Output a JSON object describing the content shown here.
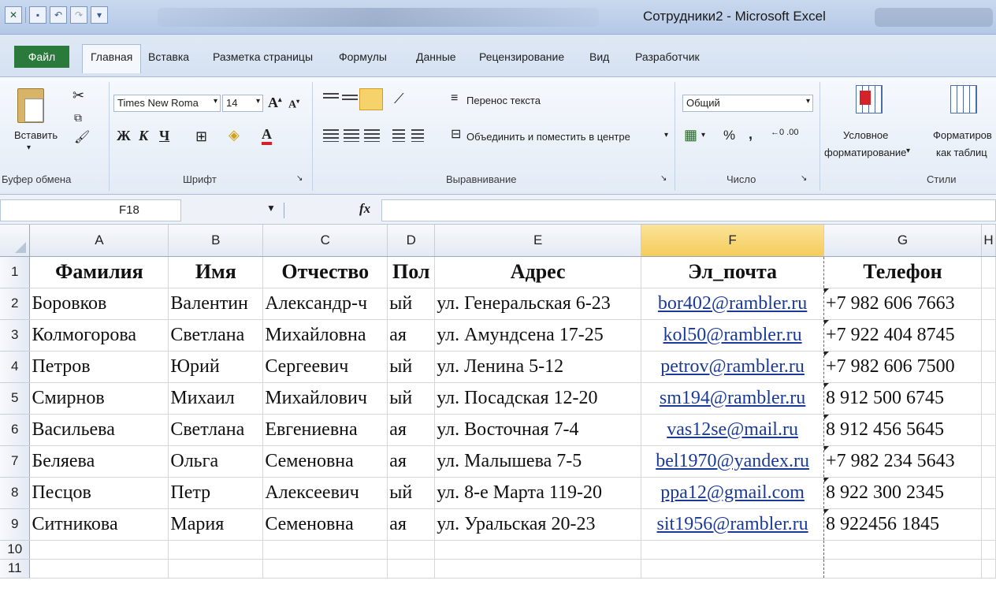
{
  "window": {
    "title": "Сотрудники2 - Microsoft Excel"
  },
  "tabs": {
    "file": "Файл",
    "items": [
      "Главная",
      "Вставка",
      "Разметка страницы",
      "Формулы",
      "Данные",
      "Рецензирование",
      "Вид",
      "Разработчик"
    ]
  },
  "ribbon": {
    "clipboard": {
      "paste_label": "Вставить",
      "group_label": "Буфер обмена"
    },
    "font": {
      "name": "Times New Roma",
      "size": "14",
      "bold": "Ж",
      "italic": "К",
      "underline": "Ч",
      "group_label": "Шрифт"
    },
    "alignment": {
      "wrap_text": "Перенос текста",
      "merge_center": "Объединить и поместить в центре",
      "group_label": "Выравнивание"
    },
    "number": {
      "format": "Общий",
      "percent": "%",
      "comma": ",",
      "group_label": "Число"
    },
    "styles": {
      "conditional_line1": "Условное",
      "conditional_line2": "форматирование",
      "format_table_line1": "Форматиров",
      "format_table_line2": "как таблиц",
      "group_label": "Стили"
    }
  },
  "formula_bar": {
    "name_box": "F18",
    "fx": "fx",
    "value": ""
  },
  "grid": {
    "columns": [
      "A",
      "B",
      "C",
      "D",
      "E",
      "F",
      "G",
      "H"
    ],
    "selected_column": "F",
    "rows": [
      {
        "n": "1",
        "cells": [
          "Фамилия",
          "Имя",
          "Отчество",
          "Пол",
          "Адрес",
          "Эл_почта",
          "Телефон",
          ""
        ]
      },
      {
        "n": "2",
        "cells": [
          "Боровков",
          "Валентин",
          "Александр-ч",
          "ый",
          "ул. Генеральская 6-23",
          "bor402@rambler.ru",
          "+7 982 606 7663",
          ""
        ]
      },
      {
        "n": "3",
        "cells": [
          "Колмогорова",
          "Светлана",
          "Михайловна",
          "ая",
          "ул. Амундсена 17-25",
          "kol50@rambler.ru",
          "+7 922 404 8745",
          ""
        ]
      },
      {
        "n": "4",
        "cells": [
          "Петров",
          "Юрий",
          "Сергеевич",
          "ый",
          "ул. Ленина 5-12",
          "petrov@rambler.ru",
          "+7 982 606 7500",
          ""
        ]
      },
      {
        "n": "5",
        "cells": [
          "Смирнов",
          "Михаил",
          "Михайлович",
          "ый",
          "ул. Посадская 12-20",
          "sm194@rambler.ru",
          "8 912 500 6745",
          ""
        ]
      },
      {
        "n": "6",
        "cells": [
          "Васильева",
          "Светлана",
          "Евгениевна",
          "ая",
          "ул. Восточная 7-4",
          "vas12se@mail.ru",
          "8 912 456 5645",
          ""
        ]
      },
      {
        "n": "7",
        "cells": [
          "Беляева",
          "Ольга",
          "Семеновна",
          "ая",
          "ул. Малышева 7-5",
          "bel1970@yandex.ru",
          "+7 982 234 5643",
          ""
        ]
      },
      {
        "n": "8",
        "cells": [
          "Песцов",
          "Петр",
          "Алексеевич",
          "ый",
          "ул. 8-е Марта 119-20",
          "ppa12@gmail.com",
          "8 922 300 2345",
          ""
        ]
      },
      {
        "n": "9",
        "cells": [
          "Ситникова",
          "Мария",
          "Семеновна",
          "ая",
          "ул. Уральская 20-23",
          "sit1956@rambler.ru",
          "8 922456 1845",
          ""
        ]
      },
      {
        "n": "10",
        "cells": [
          "",
          "",
          "",
          "",
          "",
          "",
          "",
          ""
        ]
      },
      {
        "n": "11",
        "cells": [
          "",
          "",
          "",
          "",
          "",
          "",
          "",
          ""
        ]
      }
    ]
  }
}
